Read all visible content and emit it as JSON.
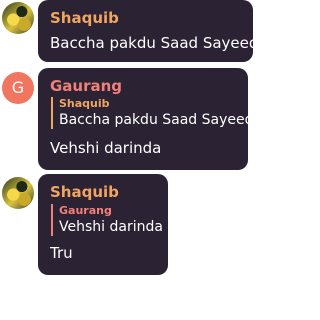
{
  "messages": [
    {
      "sender": "Shaquib",
      "avatar": "avatar-photo",
      "text": "Baccha pakdu Saad Sayeed"
    },
    {
      "sender": "Gaurang",
      "avatar_letter": "G",
      "reply_to": {
        "sender": "Shaquib",
        "text": "Baccha pakdu Saad Sayeed"
      },
      "text": "Vehshi darinda"
    },
    {
      "sender": "Shaquib",
      "avatar": "avatar-photo",
      "reply_to": {
        "sender": "Gaurang",
        "text": "Vehshi darinda"
      },
      "text": "Tru"
    }
  ],
  "colors": {
    "bubble_bg": "#2b2233",
    "shaquib_name": "#f0a560",
    "gaurang_name": "#f0807a",
    "gaurang_avatar": "#f0765f",
    "message_text": "#ffffff"
  }
}
